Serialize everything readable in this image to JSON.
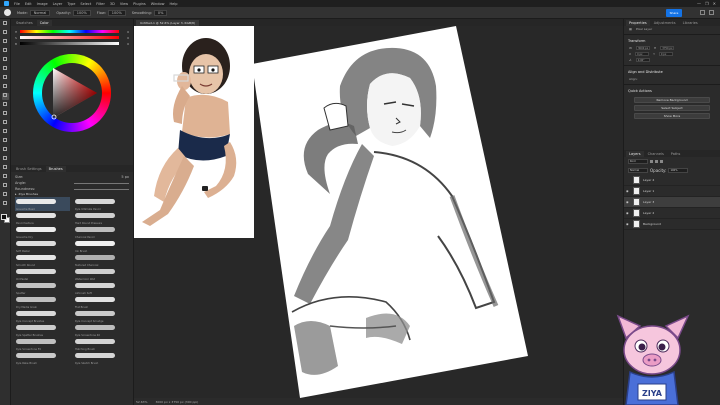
{
  "app": {
    "menu": [
      "File",
      "Edit",
      "Image",
      "Layer",
      "Type",
      "Select",
      "Filter",
      "3D",
      "View",
      "Plugins",
      "Window",
      "Help"
    ],
    "window_controls": [
      "—",
      "❐",
      "✕"
    ]
  },
  "options_bar": {
    "mode_label": "Mode:",
    "mode_value": "Normal",
    "opacity_label": "Opacity:",
    "opacity_value": "100%",
    "flow_label": "Flow:",
    "flow_value": "100%",
    "smoothing_label": "Smoothing:",
    "smoothing_value": "0%",
    "share_label": "Share"
  },
  "color_panel": {
    "tabs": [
      "Swatches",
      "Color"
    ],
    "active_tab": "Color",
    "sliders": [
      {
        "label": "H",
        "value": "0",
        "gradient": "linear-gradient(90deg,#ff0000,#ffff00,#00ff00,#00ffff,#0000ff,#ff00ff,#ff0000)"
      },
      {
        "label": "S",
        "value": "0",
        "gradient": "linear-gradient(90deg,#ffffff,#ff0000)"
      },
      {
        "label": "B",
        "value": "0",
        "gradient": "linear-gradient(90deg,#000000,#ffffff)"
      }
    ]
  },
  "brush_panel": {
    "tabs": [
      "Brush Settings",
      "Brushes"
    ],
    "active_tab": "Brushes",
    "size_label": "Size:",
    "size_value": "5 px",
    "angle_label": "Angle:",
    "roundness_label": "Roundness:",
    "folder_name": "Ziya Brushes",
    "brushes": [
      {
        "name": "Gouache Basic",
        "color": "#e9e9e9",
        "selected": true
      },
      {
        "name": "Kyle Ultimate Pencil",
        "color": "#d8d8d8",
        "selected": false
      },
      {
        "name": "Pencil texture",
        "color": "#e3e3e3",
        "selected": false
      },
      {
        "name": "Hard Round Pressure",
        "color": "#d0d0d0",
        "selected": false
      },
      {
        "name": "Gouache Dry",
        "color": "#ececec",
        "selected": false
      },
      {
        "name": "Charcoal Pencil",
        "color": "#bcbcbc",
        "selected": false
      },
      {
        "name": "Soft Pastel",
        "color": "#dedede",
        "selected": false
      },
      {
        "name": "Ink Brush",
        "color": "#f0f0f0",
        "selected": false
      },
      {
        "name": "Smooth Round",
        "color": "#e6e6e6",
        "selected": false
      },
      {
        "name": "Textured Charcoal",
        "color": "#b0b0b0",
        "selected": false
      },
      {
        "name": "Oil Pastel",
        "color": "#dadada",
        "selected": false
      },
      {
        "name": "Watercolor Wet",
        "color": "#cfcfcf",
        "selected": false
      },
      {
        "name": "Spatter",
        "color": "#c4c4c4",
        "selected": false
      },
      {
        "name": "Airbrush Soft",
        "color": "#d4d4d4",
        "selected": false
      },
      {
        "name": "Dry Media Grain",
        "color": "#bfbfbf",
        "selected": false
      },
      {
        "name": "Flat Brush",
        "color": "#e1e1e1",
        "selected": false
      },
      {
        "name": "Kyle Concept Brushes",
        "color": "#d9d9d9",
        "selected": false
      },
      {
        "name": "Kyle Concept Smudge",
        "color": "#c9c9c9",
        "selected": false
      },
      {
        "name": "Kyle Spatter Brushes",
        "color": "#cccccc",
        "selected": false
      },
      {
        "name": "Kyle Screentone 40",
        "color": "#bdbdbd",
        "selected": false
      },
      {
        "name": "Kyle Screentone 55",
        "color": "#c0c0c0",
        "selected": false
      },
      {
        "name": "Hatching Brush",
        "color": "#d3d3d3",
        "selected": false
      },
      {
        "name": "Kyle Rake Brush",
        "color": "#cacaca",
        "selected": false
      },
      {
        "name": "Kyle Sketch Brush",
        "color": "#d5d5d5",
        "selected": false
      }
    ]
  },
  "document": {
    "tab_title": "Untitled-1 @ 52.6% (Layer 3, RGB/8)",
    "zoom": "52.63%",
    "doc_info": "3000 px x 3750 px (300 ppi)"
  },
  "right_panel": {
    "properties_tabs": [
      "Properties",
      "Adjustments",
      "Libraries"
    ],
    "layer_type": "Pixel Layer",
    "transform_title": "Transform",
    "w_value": "3000 px",
    "h_value": "3750 px",
    "x_value": "0 px",
    "y_value": "0 px",
    "angle_value": "0.00°",
    "align_title": "Align and Distribute",
    "align_label": "Align:",
    "quick_actions_title": "Quick Actions",
    "quick_actions": [
      "Remove Background",
      "Select Subject",
      "Show More"
    ],
    "layers_tabs": [
      "Layers",
      "Channels",
      "Paths"
    ],
    "kind_label": "Kind",
    "blend_mode": "Normal",
    "opacity_label": "Opacity:",
    "opacity_value": "100%",
    "layers": [
      {
        "name": "Layer 4",
        "visible": false,
        "active": false
      },
      {
        "name": "Layer 1",
        "visible": true,
        "active": false
      },
      {
        "name": "Layer 3",
        "visible": true,
        "active": true
      },
      {
        "name": "Layer 2",
        "visible": true,
        "active": false
      },
      {
        "name": "Background",
        "visible": true,
        "active": false
      }
    ]
  },
  "mascot": {
    "badge_text": "ZIYA"
  }
}
